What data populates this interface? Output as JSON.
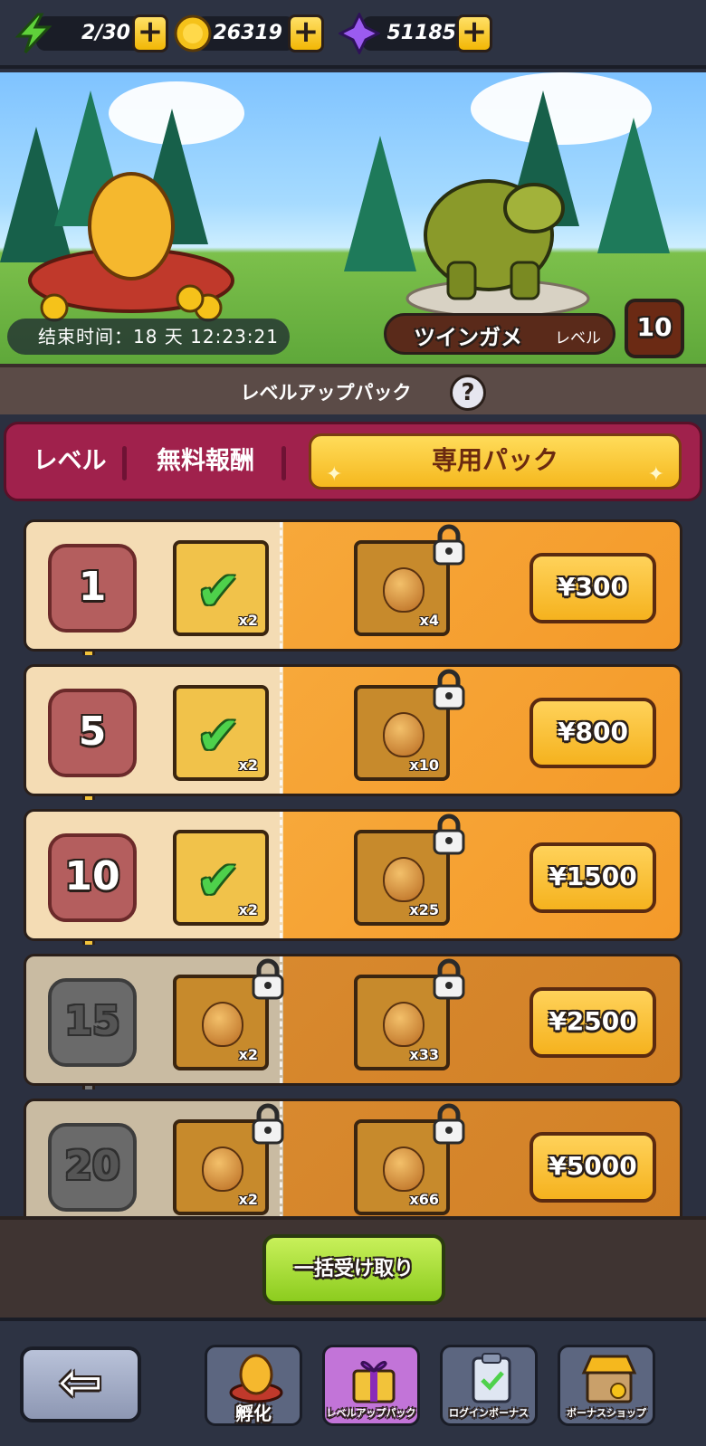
{
  "resources": {
    "energy": {
      "value": "2/30",
      "icon": "lightning-icon"
    },
    "coins": {
      "value": "26319",
      "icon": "coin-icon"
    },
    "gems": {
      "value": "51185",
      "icon": "gem-icon"
    },
    "plus_label": "+"
  },
  "banner": {
    "timer": "结束时间：18 天 12:23:21",
    "monster_name": "ツインガメ",
    "level_label": "レベル",
    "level_value": "10"
  },
  "section": {
    "title": "レベルアップパック",
    "help": "?"
  },
  "tabs": {
    "level": "レベル",
    "free": "無料報酬",
    "pack": "専用パック",
    "active": "pack"
  },
  "rows": [
    {
      "level": "1",
      "free_qty": "x2",
      "paid_qty": "x4",
      "price": "¥300",
      "claimed": true
    },
    {
      "level": "5",
      "free_qty": "x2",
      "paid_qty": "x10",
      "price": "¥800",
      "claimed": true
    },
    {
      "level": "10",
      "free_qty": "x2",
      "paid_qty": "x25",
      "price": "¥1500",
      "claimed": true
    },
    {
      "level": "15",
      "free_qty": "x2",
      "paid_qty": "x33",
      "price": "¥2500",
      "claimed": false
    },
    {
      "level": "20",
      "free_qty": "x2",
      "paid_qty": "x66",
      "price": "¥5000",
      "claimed": false
    }
  ],
  "claim_all": "一括受け取り",
  "nav": {
    "back": "⇦",
    "hatch": "孵化",
    "levelup_pack": "レベルアップパック",
    "login_bonus": "ログインボーナス",
    "bonus_shop": "ボーナスショップ"
  },
  "colors": {
    "accent": "#a0214c",
    "gold": "#f5b81e",
    "green": "#8ccc1e"
  }
}
